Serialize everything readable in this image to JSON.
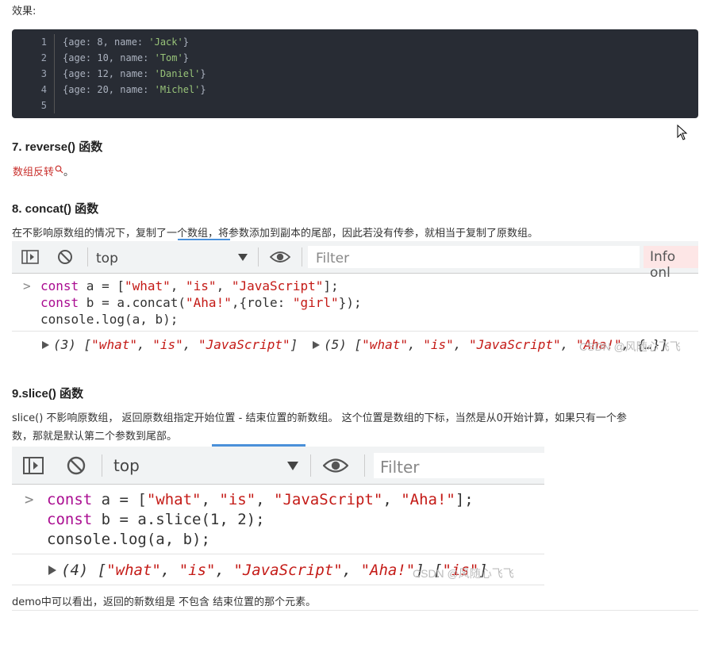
{
  "intro": {
    "effect_label": "效果:"
  },
  "code_block": {
    "line_numbers": [
      "1",
      "2",
      "3",
      "4",
      "5"
    ],
    "lines": [
      {
        "pre": "{age: 8, name: ",
        "str": "'Jack'",
        "post": "}"
      },
      {
        "pre": "{age: 10, name: ",
        "str": "'Tom'",
        "post": "}"
      },
      {
        "pre": "{age: 12, name: ",
        "str": "'Daniel'",
        "post": "}"
      },
      {
        "pre": "{age: 20, name: ",
        "str": "'Michel'",
        "post": "}"
      },
      {
        "pre": "",
        "str": "",
        "post": ""
      }
    ]
  },
  "section7": {
    "heading": "7. reverse() 函数",
    "link_text": "数组反转",
    "trail": "。"
  },
  "section8": {
    "heading": "8. concat() 函数",
    "desc": "在不影响原数组的情况下，复制了一个数组，将参数添加到副本的尾部，因此若没有传参，就相当于复制了原数组。",
    "toolbar": {
      "context": "top",
      "filter_placeholder": "Filter",
      "levels": "Info onl"
    },
    "console": {
      "prompt": ">",
      "l1": {
        "kw": "const",
        "a": " a = [",
        "s1": "\"what\"",
        "c1": ", ",
        "s2": "\"is\"",
        "c2": ", ",
        "s3": "\"JavaScript\"",
        "end": "];"
      },
      "l2": {
        "kw": "const",
        "a": " b = a.concat(",
        "s1": "\"Aha!\"",
        "mid": ",{role: ",
        "s2": "\"girl\"",
        "end": "});"
      },
      "l3": "console.log(a, b);",
      "out_a_prefix": "(3) [",
      "out_a_items": [
        "\"what\"",
        "\"is\"",
        "\"JavaScript\""
      ],
      "out_b_prefix": "(5) [",
      "out_b_items": [
        "\"what\"",
        "\"is\"",
        "\"JavaScript\"",
        "\"Aha!\""
      ],
      "out_b_tail": ", {…}]"
    },
    "watermark": "CSDN @风随心飞飞"
  },
  "section9": {
    "heading": "9.slice() 函数",
    "desc_line1": "slice() 不影响原数组， 返回原数组指定开始位置 - 结束位置的新数组。 这个位置是数组的下标，当然是从0开始计算，如果只有一个参",
    "desc_line2": "数，那就是默认第二个参数到尾部。",
    "toolbar": {
      "context": "top",
      "filter_placeholder": "Filter"
    },
    "console": {
      "prompt": ">",
      "l1": {
        "kw": "const",
        "a": " a = [",
        "s1": "\"what\"",
        "c1": ", ",
        "s2": "\"is\"",
        "c2": ", ",
        "s3": "\"JavaScript\"",
        "c3": ", ",
        "s4": "\"Aha!\"",
        "end": "];"
      },
      "l2": {
        "kw": "const",
        "a": " b = a.slice(1, 2);"
      },
      "l3": "console.log(a, b);",
      "out_prefix": "(4) [",
      "out_items": [
        "\"what\"",
        "\"is\"",
        "\"JavaScript\"",
        "\"Aha!\""
      ],
      "out_tail": "] [",
      "out_b_item": "\"is\"",
      "out_b_end": "]"
    },
    "watermark": "CSDN @风随心飞飞"
  },
  "footer": {
    "text": "demo中可以看出，返回的新数组是 不包含 结束位置的那个元素。"
  }
}
